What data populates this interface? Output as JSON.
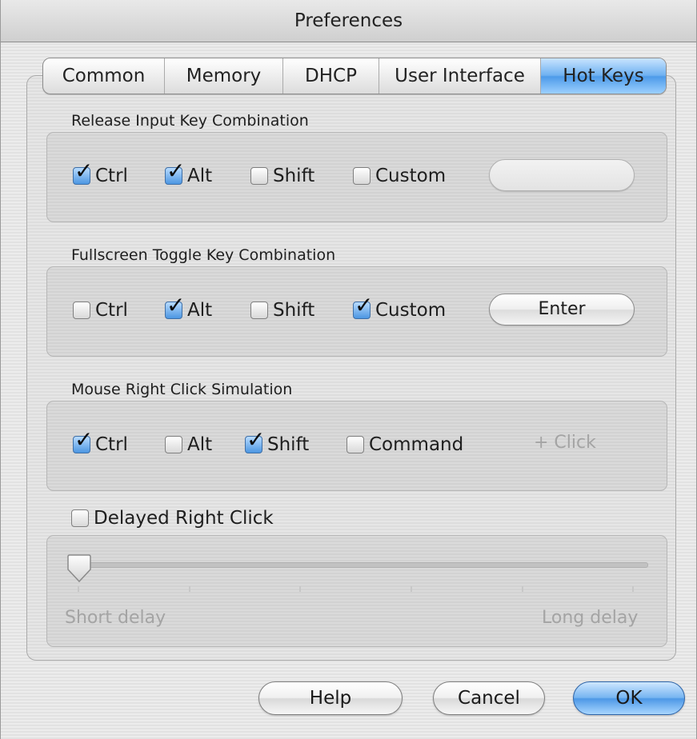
{
  "window": {
    "title": "Preferences"
  },
  "tabs": [
    {
      "label": "Common",
      "active": false
    },
    {
      "label": "Memory",
      "active": false
    },
    {
      "label": "DHCP",
      "active": false
    },
    {
      "label": "User Interface",
      "active": false
    },
    {
      "label": "Hot Keys",
      "active": true
    }
  ],
  "release_input": {
    "title": "Release Input Key Combination",
    "checkboxes": [
      {
        "label": "Ctrl",
        "checked": true
      },
      {
        "label": "Alt",
        "checked": true
      },
      {
        "label": "Shift",
        "checked": false
      },
      {
        "label": "Custom",
        "checked": false
      }
    ],
    "custom_key": ""
  },
  "fullscreen_toggle": {
    "title": "Fullscreen Toggle Key Combination",
    "checkboxes": [
      {
        "label": "Ctrl",
        "checked": false
      },
      {
        "label": "Alt",
        "checked": true
      },
      {
        "label": "Shift",
        "checked": false
      },
      {
        "label": "Custom",
        "checked": true
      }
    ],
    "custom_key": "Enter"
  },
  "mouse_right_click": {
    "title": "Mouse Right Click Simulation",
    "checkboxes": [
      {
        "label": "Ctrl",
        "checked": true
      },
      {
        "label": "Alt",
        "checked": false
      },
      {
        "label": "Shift",
        "checked": true
      },
      {
        "label": "Command",
        "checked": false
      }
    ],
    "suffix": "+ Click"
  },
  "delayed_right_click": {
    "label": "Delayed Right Click",
    "checked": false,
    "slider": {
      "min_label": "Short delay",
      "max_label": "Long delay",
      "value": 0,
      "enabled": false
    }
  },
  "buttons": {
    "help": "Help",
    "cancel": "Cancel",
    "ok": "OK"
  },
  "colors": {
    "accent_blue": "#4d98e6",
    "checkbox_checked": "#4c96e2"
  },
  "icons": {
    "checkmark": "checkmark-icon",
    "slider_thumb": "slider-thumb-icon"
  }
}
